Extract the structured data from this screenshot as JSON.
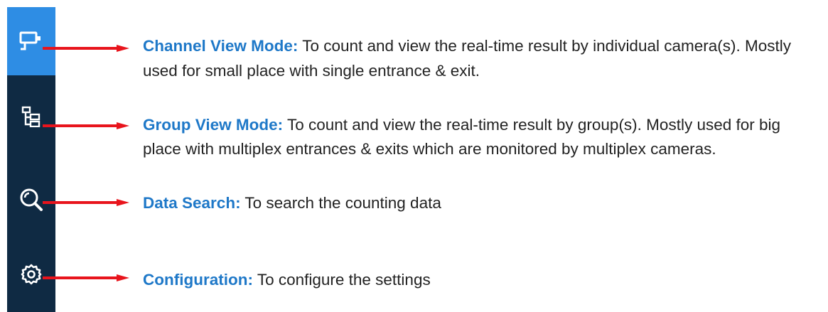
{
  "sidebar": {
    "items": [
      {
        "icon": "camera-icon",
        "active": true
      },
      {
        "icon": "group-tree-icon",
        "active": false
      },
      {
        "icon": "search-icon",
        "active": false
      },
      {
        "icon": "gear-icon",
        "active": false
      }
    ]
  },
  "entries": [
    {
      "term": "Channel View Mode:",
      "text": " To count and view the real-time result by individual camera(s). Mostly used for small place with single entrance & exit."
    },
    {
      "term": "Group View Mode:",
      "text": " To count and view the real-time result by group(s). Mostly used for big place with multiplex entrances & exits which are monitored by multiplex cameras."
    },
    {
      "term": "Data Search:",
      "text": " To search the counting data"
    },
    {
      "term": "Configuration:",
      "text": " To configure the settings"
    }
  ],
  "colors": {
    "sidebar_bg": "#0f2a43",
    "active_tile": "#2e8de4",
    "icon": "#ffffff",
    "arrow": "#e8141c",
    "term": "#1e78c8",
    "text": "#222222"
  }
}
